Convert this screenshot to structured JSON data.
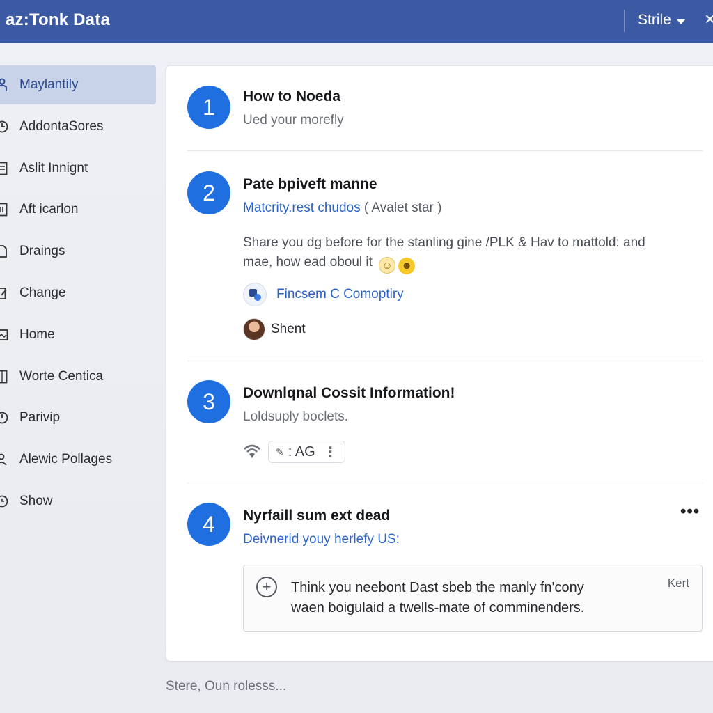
{
  "app": {
    "title": "az:Tonk Data"
  },
  "topbar": {
    "menu_label": "Strile",
    "close_label": "×"
  },
  "sidebar": {
    "items": [
      {
        "label": "Maylantily",
        "icon": "person-icon",
        "active": true
      },
      {
        "label": "AddontaSores",
        "icon": "clock-icon"
      },
      {
        "label": "Aslit Innignt",
        "icon": "document-icon"
      },
      {
        "label": "Aft icarlon",
        "icon": "list-icon"
      },
      {
        "label": "Draings",
        "icon": "page-icon"
      },
      {
        "label": "Change",
        "icon": "edit-icon"
      },
      {
        "label": "Home",
        "icon": "image-icon"
      },
      {
        "label": "Worte Centica",
        "icon": "file-icon"
      },
      {
        "label": "Parivip",
        "icon": "pin-icon"
      },
      {
        "label": "Alewic Pollages",
        "icon": "users-icon"
      },
      {
        "label": "Show",
        "icon": "circle-icon"
      }
    ]
  },
  "steps": [
    {
      "number": "1",
      "title": "How to Noeda",
      "subtitle": "Ued your morefly"
    },
    {
      "number": "2",
      "title": "Pate bpiveft manne",
      "link": "Matcrity.rest chudos",
      "link_suffix": "( Avalet star )",
      "body_line1": "Share you dg before for the stanling gine /PLK & Hav to mattold: and",
      "body_line2": "mae, how ead oboul it ",
      "attachment": "Fincsem C Comoptiry",
      "user": "Shent"
    },
    {
      "number": "3",
      "title": "Downlqnal Cossit Information!",
      "subtitle": "Loldsuply boclets.",
      "chip": ": AG"
    },
    {
      "number": "4",
      "title": "Nyrfaill sum ext dead",
      "link": "Deivnerid youy herlefy US:",
      "comment_line1": "Think you neebont Dast sbeb the manly fn'cony",
      "comment_line2": "waen boigulaid a twells-mate of comminenders.",
      "comment_tag": "Kert"
    }
  ],
  "footer": {
    "text": "Stere, Oun rolesss..."
  },
  "colors": {
    "topbar": "#3b5aa3",
    "accent": "#1f6fe0",
    "link": "#2a63c6",
    "sidebar_active": "#c9d3e8"
  }
}
